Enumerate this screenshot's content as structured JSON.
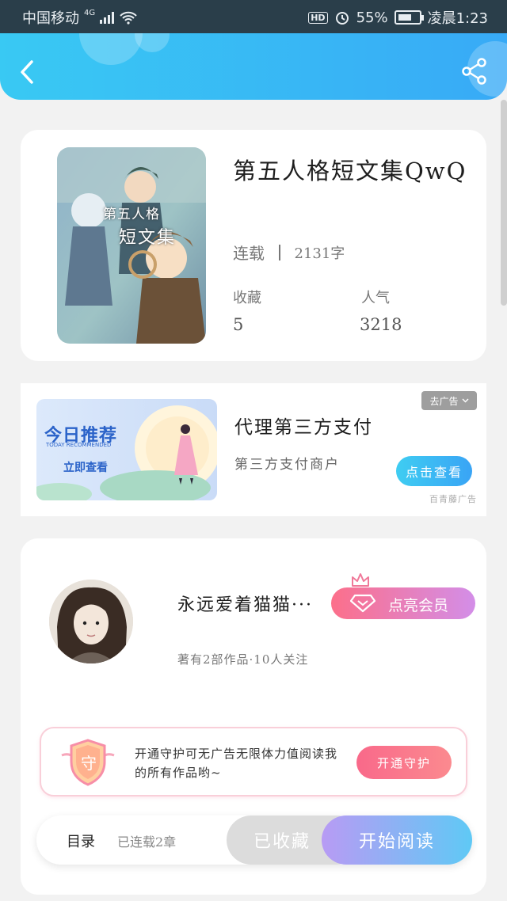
{
  "status_bar": {
    "carrier": "中国移动",
    "network": "4G",
    "hd": "HD",
    "battery_percent": "55%",
    "time": "凌晨1:23"
  },
  "header": {
    "back_icon": "chevron-left-icon",
    "share_icon": "share-icon"
  },
  "book": {
    "title": "第五人格短文集QwQ",
    "cover_text_line1": "第五人格",
    "cover_text_line2": "短文集",
    "status": "连载",
    "word_count": "2131字",
    "stats": {
      "favorites_label": "收藏",
      "favorites_value": "5",
      "popularity_label": "人气",
      "popularity_value": "3218"
    }
  },
  "ad": {
    "banner_title": "今日推荐",
    "banner_subtitle": "TODAY RECOMMENDED",
    "banner_cta": "立即查看",
    "close_label": "去广告",
    "title": "代理第三方支付",
    "subtitle": "第三方支付商户",
    "button": "点击查看",
    "source": "百青藤广告"
  },
  "author": {
    "name": "永远爱着猫猫···",
    "vip_button": "点亮会员",
    "stats": "著有2部作品·10人关注",
    "guard_badge": "守",
    "guard_text": "开通守护可无广告无限体力值阅读我的所有作品哟~",
    "guard_button": "开通守护"
  },
  "bottom_bar": {
    "toc_label": "目录",
    "chapter_count": "已连载2章",
    "collected_button": "已收藏",
    "read_button": "开始阅读"
  },
  "colors": {
    "header_start": "#39c9f3",
    "header_end": "#38aaf6",
    "vip_start": "#fc6f8a",
    "vip_end": "#d38ee8",
    "read_start": "#b89bf4",
    "read_end": "#5fc9f5"
  }
}
